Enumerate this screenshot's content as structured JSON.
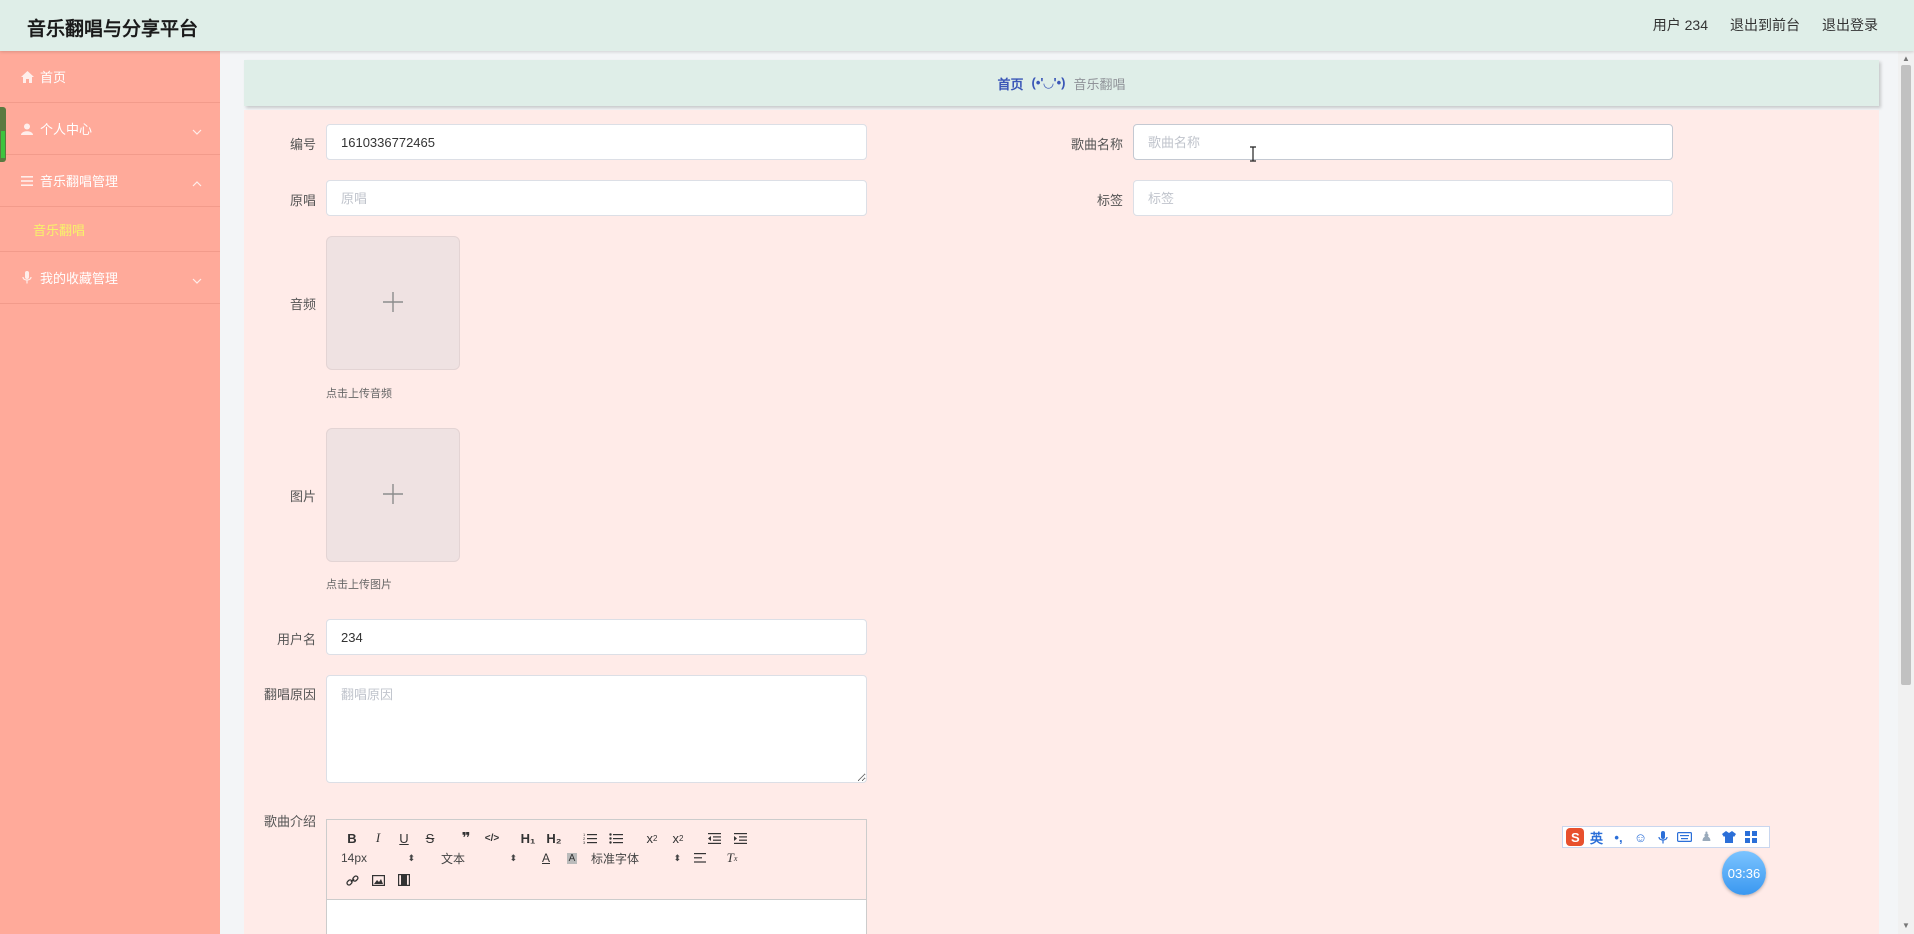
{
  "app": {
    "title": "音乐翻唱与分享平台"
  },
  "header": {
    "user_label": "用户 234",
    "back_front": "退出到前台",
    "logout": "退出登录"
  },
  "sidebar": {
    "items": [
      {
        "label": "首页",
        "icon": "home-icon"
      },
      {
        "label": "个人中心",
        "icon": "user-icon"
      },
      {
        "label": "音乐翻唱管理",
        "icon": "menu-icon"
      },
      {
        "label": "音乐翻唱",
        "icon": ""
      },
      {
        "label": "我的收藏管理",
        "icon": "mic-icon"
      }
    ]
  },
  "breadcrumb": {
    "home": "首页",
    "separator": "(•'◡'•)",
    "current": "音乐翻唱"
  },
  "form": {
    "id": {
      "label": "编号",
      "value": "1610336772465"
    },
    "song_name": {
      "label": "歌曲名称",
      "placeholder": "歌曲名称"
    },
    "original": {
      "label": "原唱",
      "placeholder": "原唱"
    },
    "tag": {
      "label": "标签",
      "placeholder": "标签"
    },
    "audio": {
      "label": "音频",
      "hint": "点击上传音频"
    },
    "image": {
      "label": "图片",
      "hint": "点击上传图片"
    },
    "username": {
      "label": "用户名",
      "value": "234"
    },
    "reason": {
      "label": "翻唱原因",
      "placeholder": "翻唱原因"
    },
    "intro": {
      "label": "歌曲介绍"
    }
  },
  "editor": {
    "font_size": "14px",
    "paragraph": "文本",
    "font_family": "标准字体"
  },
  "ime": {
    "lang": "英"
  },
  "clock": {
    "time": "03:36"
  },
  "colors": {
    "topbar": "#dfeee8",
    "sidebar": "#ffaa9a",
    "panel": "#ffebe8",
    "active_submenu": "#f7f36a",
    "breadcrumb_link": "#3a56b7"
  }
}
